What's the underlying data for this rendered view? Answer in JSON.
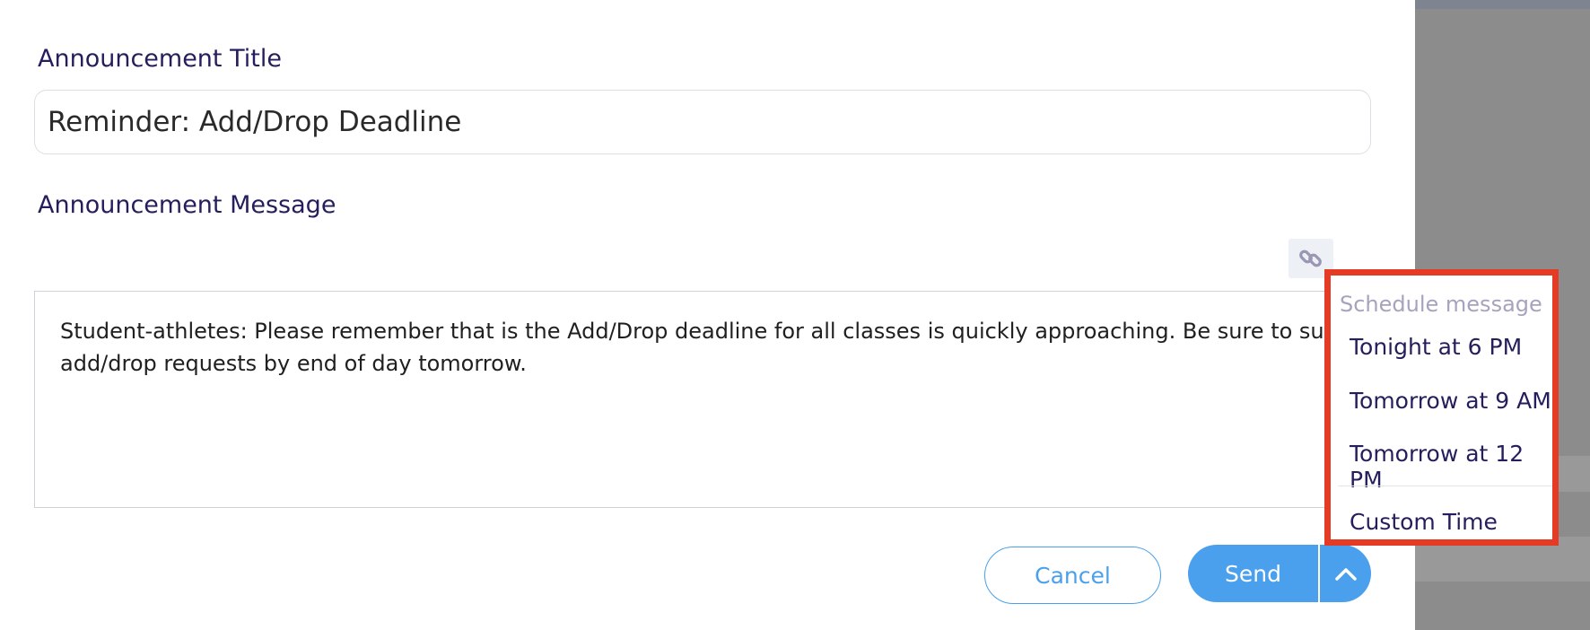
{
  "form": {
    "title_label": "Announcement Title",
    "title_value": "Reminder: Add/Drop Deadline",
    "message_label": "Announcement Message",
    "message_value": "Student-athletes: Please remember that is the Add/Drop deadline for all classes is quickly approaching. Be sure to submit your add/drop requests by end of day tomorrow."
  },
  "toolbar": {
    "link_icon": "link-icon"
  },
  "actions": {
    "cancel_label": "Cancel",
    "send_label": "Send",
    "toggle_icon": "chevron-up-icon"
  },
  "schedule_menu": {
    "header": "Schedule message",
    "options": [
      "Tonight at 6 PM",
      "Tomorrow at 9 AM",
      "Tomorrow at 12 PM"
    ],
    "custom_label": "Custom Time"
  },
  "colors": {
    "accent": "#4aa0ec",
    "label_text": "#241f5c",
    "highlight": "#e53b24"
  }
}
